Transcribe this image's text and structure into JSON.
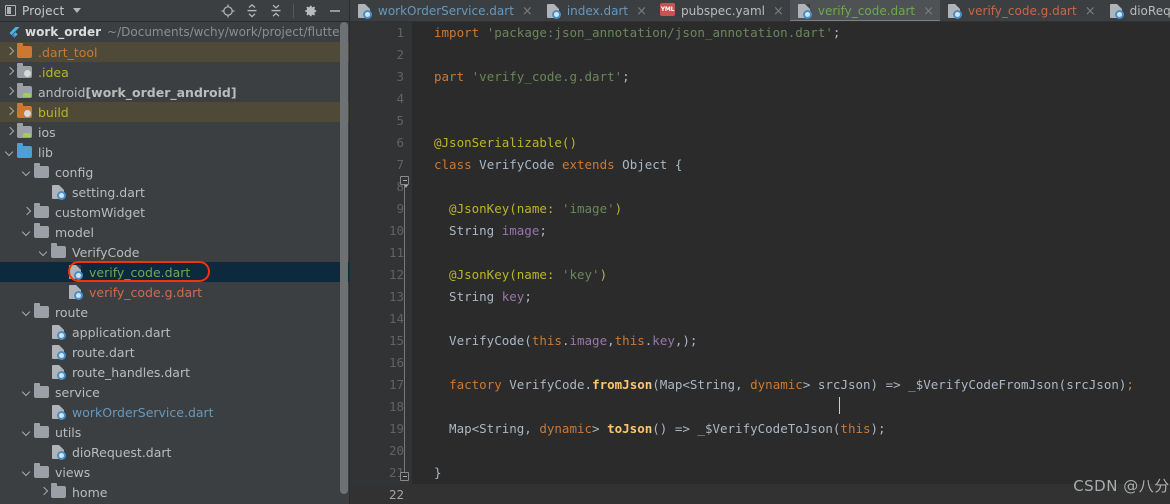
{
  "toolbar": {
    "project_label": "Project",
    "dropdown_icon": "chevron-down-icon",
    "icons": [
      {
        "name": "locate-target-icon",
        "label": "Select Opened File"
      },
      {
        "name": "expand-all-icon",
        "label": "Expand All"
      },
      {
        "name": "collapse-all-icon",
        "label": "Collapse All"
      },
      {
        "name": "gear-icon",
        "label": "Settings"
      },
      {
        "name": "minimize-icon",
        "label": "Hide"
      }
    ]
  },
  "project": {
    "root_name": "work_order",
    "root_path": "~/Documents/wchy/work/project/flutter/",
    "root_icon": "flutter-icon"
  },
  "tree": [
    {
      "label": ".dart_tool",
      "depth": 1,
      "arrow": "right",
      "icon": "folder-orange",
      "color": "orange",
      "state": "hover"
    },
    {
      "label": ".idea",
      "depth": 1,
      "arrow": "right",
      "icon": "folder-excluded",
      "color": "yellow",
      "state": "normal"
    },
    {
      "label": "android ",
      "bold": "[work_order_android]",
      "depth": 1,
      "arrow": "right",
      "icon": "folder-android",
      "color": "gray",
      "state": "normal"
    },
    {
      "label": "build",
      "depth": 1,
      "arrow": "right",
      "icon": "folder-orange-excluded",
      "color": "yellow",
      "state": "hover"
    },
    {
      "label": "ios",
      "depth": 1,
      "arrow": "right",
      "icon": "folder-android",
      "color": "gray",
      "state": "normal"
    },
    {
      "label": "lib",
      "depth": 1,
      "arrow": "down",
      "icon": "folder-blue",
      "color": "gray",
      "state": "normal"
    },
    {
      "label": "config",
      "depth": 2,
      "arrow": "down",
      "icon": "folder",
      "color": "gray",
      "state": "normal"
    },
    {
      "label": "setting.dart",
      "depth": 3,
      "arrow": "none",
      "icon": "dart-file",
      "color": "gray",
      "state": "normal"
    },
    {
      "label": "customWidget",
      "depth": 2,
      "arrow": "right",
      "icon": "folder",
      "color": "gray",
      "state": "normal"
    },
    {
      "label": "model",
      "depth": 2,
      "arrow": "down",
      "icon": "folder",
      "color": "gray",
      "state": "normal"
    },
    {
      "label": "VerifyCode",
      "depth": 3,
      "arrow": "down",
      "icon": "folder",
      "color": "gray",
      "state": "normal"
    },
    {
      "label": "verify_code.dart",
      "depth": 4,
      "arrow": "none",
      "icon": "dart-file",
      "color": "green",
      "state": "selected"
    },
    {
      "label": "verify_code.g.dart",
      "depth": 4,
      "arrow": "none",
      "icon": "dart-file",
      "color": "salmon",
      "state": "normal"
    },
    {
      "label": "route",
      "depth": 2,
      "arrow": "down",
      "icon": "folder",
      "color": "gray",
      "state": "normal"
    },
    {
      "label": "application.dart",
      "depth": 3,
      "arrow": "none",
      "icon": "dart-file",
      "color": "gray",
      "state": "normal"
    },
    {
      "label": "route.dart",
      "depth": 3,
      "arrow": "none",
      "icon": "dart-file",
      "color": "gray",
      "state": "normal"
    },
    {
      "label": "route_handles.dart",
      "depth": 3,
      "arrow": "none",
      "icon": "dart-file",
      "color": "gray",
      "state": "normal"
    },
    {
      "label": "service",
      "depth": 2,
      "arrow": "down",
      "icon": "folder",
      "color": "gray",
      "state": "normal"
    },
    {
      "label": "workOrderService.dart",
      "depth": 3,
      "arrow": "none",
      "icon": "dart-file",
      "color": "blueish",
      "state": "normal"
    },
    {
      "label": "utils",
      "depth": 2,
      "arrow": "down",
      "icon": "folder",
      "color": "gray",
      "state": "normal"
    },
    {
      "label": "dioRequest.dart",
      "depth": 3,
      "arrow": "none",
      "icon": "dart-file",
      "color": "gray",
      "state": "normal"
    },
    {
      "label": "views",
      "depth": 2,
      "arrow": "down",
      "icon": "folder",
      "color": "gray",
      "state": "normal"
    },
    {
      "label": "home",
      "depth": 3,
      "arrow": "right",
      "icon": "folder",
      "color": "gray",
      "state": "normal"
    }
  ],
  "annotation": {
    "shape": "rounded-rect",
    "color": "#f4320c",
    "target": "verify_code.dart"
  },
  "tabs": [
    {
      "label": "workOrderService.dart",
      "icon": "dart-file",
      "color": "blue",
      "active": false,
      "close": "×"
    },
    {
      "label": "index.dart",
      "icon": "dart-file",
      "color": "blue",
      "active": false,
      "close": "×"
    },
    {
      "label": "pubspec.yaml",
      "icon": "yaml-file",
      "badge": "YML",
      "color": "gray",
      "active": false,
      "close": "×"
    },
    {
      "label": "verify_code.dart",
      "icon": "dart-file",
      "color": "green",
      "active": true,
      "close": "×"
    },
    {
      "label": "verify_code.g.dart",
      "icon": "dart-file",
      "color": "salmon",
      "active": false,
      "close": "×"
    },
    {
      "label": "dioRequest.dart",
      "icon": "dart-file",
      "color": "gray",
      "active": false,
      "close": "×"
    }
  ],
  "editor": {
    "current_line": 22,
    "line_numbers": [
      1,
      2,
      3,
      4,
      5,
      6,
      7,
      8,
      9,
      10,
      11,
      12,
      13,
      14,
      15,
      16,
      17,
      18,
      19,
      20,
      21,
      22
    ],
    "lines": [
      {
        "n": 1,
        "tokens": [
          {
            "t": "import",
            "c": "k"
          },
          {
            "t": " ",
            "c": "t"
          },
          {
            "t": "'package:json_annotation/json_annotation.dart'",
            "c": "s"
          },
          {
            "t": ";",
            "c": "t"
          }
        ]
      },
      {
        "n": 2,
        "tokens": []
      },
      {
        "n": 3,
        "tokens": [
          {
            "t": "part",
            "c": "k"
          },
          {
            "t": " ",
            "c": "t"
          },
          {
            "t": "'verify_code.g.dart'",
            "c": "s"
          },
          {
            "t": ";",
            "c": "t"
          }
        ]
      },
      {
        "n": 4,
        "tokens": []
      },
      {
        "n": 5,
        "tokens": []
      },
      {
        "n": 6,
        "tokens": [
          {
            "t": "@JsonSerializable()",
            "c": "a"
          }
        ]
      },
      {
        "n": 7,
        "tokens": [
          {
            "t": "class",
            "c": "k"
          },
          {
            "t": " VerifyCode ",
            "c": "t"
          },
          {
            "t": "extends",
            "c": "k"
          },
          {
            "t": " Object {",
            "c": "t"
          }
        ]
      },
      {
        "n": 8,
        "tokens": []
      },
      {
        "n": 9,
        "tokens": [
          {
            "t": "  @JsonKey(name: ",
            "c": "a"
          },
          {
            "t": "'image'",
            "c": "s"
          },
          {
            "t": ")",
            "c": "a"
          }
        ]
      },
      {
        "n": 10,
        "tokens": [
          {
            "t": "  String ",
            "c": "t"
          },
          {
            "t": "image",
            "c": "f"
          },
          {
            "t": ";",
            "c": "t"
          }
        ]
      },
      {
        "n": 11,
        "tokens": []
      },
      {
        "n": 12,
        "tokens": [
          {
            "t": "  @JsonKey(name: ",
            "c": "a"
          },
          {
            "t": "'key'",
            "c": "s"
          },
          {
            "t": ")",
            "c": "a"
          }
        ]
      },
      {
        "n": 13,
        "tokens": [
          {
            "t": "  String ",
            "c": "t"
          },
          {
            "t": "key",
            "c": "f"
          },
          {
            "t": ";",
            "c": "t"
          }
        ]
      },
      {
        "n": 14,
        "tokens": []
      },
      {
        "n": 15,
        "tokens": [
          {
            "t": "  VerifyCode(",
            "c": "t"
          },
          {
            "t": "this",
            "c": "k"
          },
          {
            "t": ".",
            "c": "t"
          },
          {
            "t": "image",
            "c": "f"
          },
          {
            "t": ",",
            "c": "t"
          },
          {
            "t": "this",
            "c": "k"
          },
          {
            "t": ".",
            "c": "t"
          },
          {
            "t": "key",
            "c": "f"
          },
          {
            "t": ",);",
            "c": "t"
          }
        ]
      },
      {
        "n": 16,
        "tokens": []
      },
      {
        "n": 17,
        "tokens": [
          {
            "t": "  ",
            "c": "t"
          },
          {
            "t": "factory",
            "c": "k"
          },
          {
            "t": " VerifyCode.",
            "c": "t"
          },
          {
            "t": "fromJson",
            "c": "mb"
          },
          {
            "t": "(Map<String, ",
            "c": "t"
          },
          {
            "t": "dynamic",
            "c": "k"
          },
          {
            "t": "> srcJson) => _$VerifyCodeFromJson(srcJson)",
            "c": "t"
          },
          {
            "t": ";",
            "c": "k"
          }
        ]
      },
      {
        "n": 18,
        "tokens": []
      },
      {
        "n": 19,
        "tokens": [
          {
            "t": "  Map<String, ",
            "c": "t"
          },
          {
            "t": "dynamic",
            "c": "k"
          },
          {
            "t": "> ",
            "c": "t"
          },
          {
            "t": "toJson",
            "c": "mb"
          },
          {
            "t": "() => _$VerifyCodeToJson(",
            "c": "t"
          },
          {
            "t": "this",
            "c": "k"
          },
          {
            "t": ");",
            "c": "t"
          }
        ]
      },
      {
        "n": 20,
        "tokens": []
      },
      {
        "n": 21,
        "tokens": [
          {
            "t": "}",
            "c": "t"
          }
        ]
      },
      {
        "n": 22,
        "tokens": []
      }
    ]
  },
  "watermark": "CSDN @八分钟de温暖"
}
